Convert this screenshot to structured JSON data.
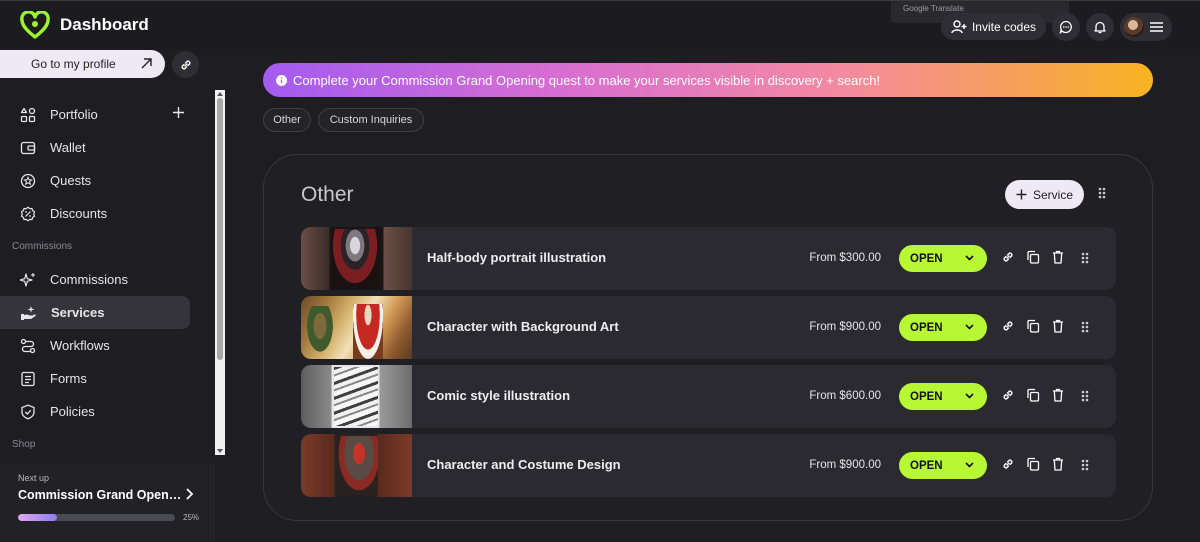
{
  "app": {
    "title": "Dashboard"
  },
  "top": {
    "translate_label": "Google Translate",
    "invite_label": "Invite codes"
  },
  "sidebar": {
    "profile_label": "Go to my profile",
    "items": [
      {
        "label": "Portfolio"
      },
      {
        "label": "Wallet"
      },
      {
        "label": "Quests"
      },
      {
        "label": "Discounts"
      },
      {
        "label": "Commissions"
      },
      {
        "label": "Services"
      },
      {
        "label": "Workflows"
      },
      {
        "label": "Forms"
      },
      {
        "label": "Policies"
      }
    ],
    "sections": {
      "commissions": "Commissions",
      "shop": "Shop"
    },
    "next_up": {
      "label": "Next up",
      "title": "Commission Grand Opening",
      "progress_text": "25%",
      "progress": 0.25
    }
  },
  "banner": {
    "text": "Complete your Commission Grand Opening quest to make your services visible in discovery + search!"
  },
  "chips": [
    "Other",
    "Custom Inquiries"
  ],
  "group": {
    "title": "Other",
    "add_label": "Service",
    "services": [
      {
        "name": "Half-body portrait illustration",
        "price": "From $300.00",
        "status": "OPEN"
      },
      {
        "name": "Character with Background Art",
        "price": "From $900.00",
        "status": "OPEN"
      },
      {
        "name": "Comic style illustration",
        "price": "From $600.00",
        "status": "OPEN"
      },
      {
        "name": "Character and Costume Design",
        "price": "From $900.00",
        "status": "OPEN"
      }
    ]
  },
  "colors": {
    "accent": "#b8f734",
    "brand": "#9cf52a",
    "banner_start": "#a35bf0",
    "banner_end": "#f9b320"
  }
}
